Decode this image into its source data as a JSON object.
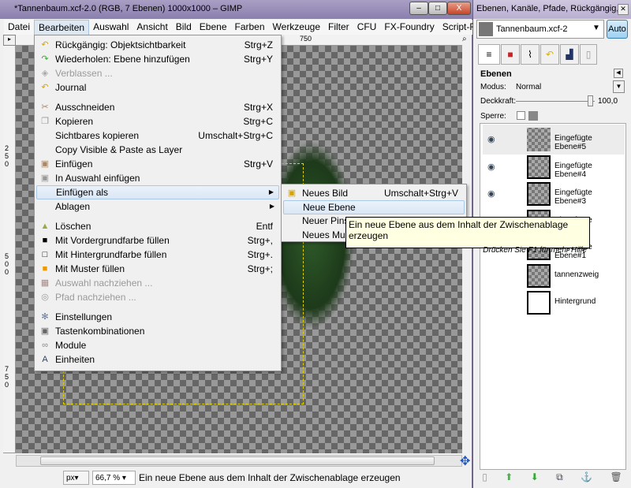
{
  "window": {
    "title": "*Tannenbaum.xcf-2.0 (RGB, 7 Ebenen) 1000x1000 – GIMP",
    "minimize": "–",
    "maximize": "□",
    "close": "X"
  },
  "menubar": [
    "Datei",
    "Bearbeiten",
    "Auswahl",
    "Ansicht",
    "Bild",
    "Ebene",
    "Farben",
    "Werkzeuge",
    "Filter",
    "CFU",
    "FX-Foundry",
    "Script-Fu"
  ],
  "rulers": {
    "h": [
      "750"
    ],
    "v": [
      "250",
      "500",
      "750"
    ]
  },
  "edit_menu": [
    {
      "label": "Rückgängig: Objektsichtbarkeit",
      "shortcut": "Strg+Z",
      "icon": "undo-icon"
    },
    {
      "label": "Wiederholen: Ebene hinzufügen",
      "shortcut": "Strg+Y",
      "icon": "redo-icon"
    },
    {
      "label": "Verblassen ...",
      "shortcut": "",
      "icon": "fade-icon",
      "disabled": true
    },
    {
      "label": "Journal",
      "shortcut": "",
      "icon": "journal-icon"
    },
    {
      "label": "Ausschneiden",
      "shortcut": "Strg+X",
      "icon": "scissors-icon"
    },
    {
      "label": "Kopieren",
      "shortcut": "Strg+C",
      "icon": "copy-icon"
    },
    {
      "label": "Sichtbares kopieren",
      "shortcut": "Umschalt+Strg+C",
      "icon": ""
    },
    {
      "label": "Copy Visible & Paste as Layer",
      "shortcut": "",
      "icon": ""
    },
    {
      "label": "Einfügen",
      "shortcut": "Strg+V",
      "icon": "paste-icon"
    },
    {
      "label": "In Auswahl einfügen",
      "shortcut": "",
      "icon": "paste-into-icon"
    },
    {
      "label": "Einfügen als",
      "shortcut": "",
      "icon": "",
      "submenu": true
    },
    {
      "label": "Ablagen",
      "shortcut": "",
      "icon": "",
      "submenu": true
    },
    {
      "label": "Löschen",
      "shortcut": "Entf",
      "icon": "clear-icon"
    },
    {
      "label": "Mit Vordergrundfarbe füllen",
      "shortcut": "Strg+,",
      "icon": "fg-fill-icon"
    },
    {
      "label": "Mit Hintergrundfarbe füllen",
      "shortcut": "Strg+.",
      "icon": "bg-fill-icon"
    },
    {
      "label": "Mit Muster füllen",
      "shortcut": "Strg+;",
      "icon": "pattern-fill-icon"
    },
    {
      "label": "Auswahl nachziehen ...",
      "shortcut": "",
      "icon": "stroke-selection-icon",
      "disabled": true
    },
    {
      "label": "Pfad nachziehen ...",
      "shortcut": "",
      "icon": "stroke-path-icon",
      "disabled": true
    },
    {
      "label": "Einstellungen",
      "shortcut": "",
      "icon": "preferences-icon"
    },
    {
      "label": "Tastenkombinationen",
      "shortcut": "",
      "icon": "keyboard-icon"
    },
    {
      "label": "Module",
      "shortcut": "",
      "icon": "module-icon"
    },
    {
      "label": "Einheiten",
      "shortcut": "",
      "icon": "units-icon"
    }
  ],
  "paste_as_menu": [
    {
      "label": "Neues Bild",
      "shortcut": "Umschalt+Strg+V"
    },
    {
      "label": "Neue Ebene",
      "shortcut": ""
    },
    {
      "label": "Neuer Pinsel",
      "shortcut": ""
    },
    {
      "label": "Neues Muster",
      "shortcut": ""
    }
  ],
  "tooltip": {
    "text": "Ein neue Ebene aus dem Inhalt der Zwischenablage erzeugen",
    "hint": "Drücken Sie F1 für mehr Hilfe"
  },
  "status": {
    "unit": "px▾",
    "zoom": "66,7 %",
    "message": "Ein neue Ebene aus dem Inhalt der Zwischenablage erzeugen"
  },
  "dock": {
    "title": "Ebenen, Kanäle, Pfade, Rückgängig, ...",
    "image": "Tannenbaum.xcf-2",
    "auto": "Auto",
    "panel": "Ebenen",
    "mode_label": "Modus:",
    "mode": "Normal",
    "opacity_label": "Deckkraft:",
    "opacity": "100,0",
    "lock_label": "Sperre:",
    "layers": [
      {
        "name": "Eingefügte Ebene#5",
        "visible": true
      },
      {
        "name": "Eingefügte Ebene#4",
        "visible": true
      },
      {
        "name": "Eingefügte Ebene#3",
        "visible": true
      },
      {
        "name": "Eingefügte Ebene#2",
        "visible": false
      },
      {
        "name": "Eingefügte Ebene#1",
        "visible": false
      },
      {
        "name": "tannenzweig",
        "visible": false
      },
      {
        "name": "Hintergrund",
        "visible": false
      }
    ]
  }
}
